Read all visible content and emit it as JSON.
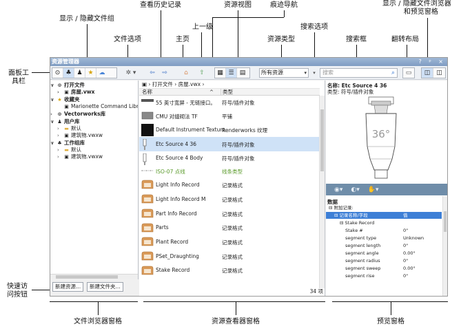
{
  "callouts": {
    "show_hide_groups": "显示 / 隐藏文件组",
    "view_history": "查看历史记录",
    "resource_view": "资源视图",
    "breadcrumb_nav": "痕迹导航",
    "show_hide_browser_1": "显示 / 隐藏文件浏览器",
    "show_hide_browser_2": "和预览窗格",
    "file_options": "文件选项",
    "home": "主页",
    "up_level": "上一级",
    "resource_type": "资源类型",
    "search_options": "搜索选项",
    "search_box": "搜索框",
    "flip_layout": "翻转布局",
    "panel_toolbar_1": "面板工",
    "panel_toolbar_2": "具栏",
    "quick_access_1": "快速访",
    "quick_access_2": "问按钮",
    "file_browser_pane": "文件浏览器窗格",
    "resource_viewer_pane": "资源查看器窗格",
    "preview_pane": "预览窗格"
  },
  "window": {
    "title": "资源管理器",
    "title_buttons": "? ᵖ ×"
  },
  "toolbar": {
    "resource_type_value": "所有资源",
    "search_placeholder": "搜索"
  },
  "tree": {
    "items": [
      {
        "label": "打开文件",
        "bold": true
      },
      {
        "label": "房屋.vwx",
        "bold": true
      },
      {
        "label": "收藏夹",
        "bold": true
      },
      {
        "label": "Marionette Command Libr",
        "bold": false
      },
      {
        "label": "Vectorworks库",
        "bold": true
      },
      {
        "label": "用户库",
        "bold": true
      },
      {
        "label": "默认",
        "bold": false
      },
      {
        "label": "建筑物.vwxw",
        "bold": false
      },
      {
        "label": "工作组库",
        "bold": true
      },
      {
        "label": "默认",
        "bold": false
      },
      {
        "label": "建筑物.vwxw",
        "bold": false
      }
    ]
  },
  "quick_access": {
    "new_resource": "新建资源...",
    "new_folder": "新建文件夹..."
  },
  "viewer": {
    "breadcrumb": [
      "打开文件",
      "房屋.vwx"
    ],
    "col_name": "名称",
    "col_type": "类型",
    "rows": [
      {
        "name": "55 英寸宽屏 - 无链接口。",
        "type": "符号/插件对象"
      },
      {
        "name": "CMU 对缝砌法 TF",
        "type": "平铺"
      },
      {
        "name": "Default Instrument Texture",
        "type": "Renderworks 纹理"
      },
      {
        "name": "Etc Source 4 36",
        "type": "符号/插件对象"
      },
      {
        "name": "Etc Source 4 Body",
        "type": "符号/插件对象"
      },
      {
        "name": "ISO-07 点线",
        "type": "线条类型"
      },
      {
        "name": "Light Info Record",
        "type": "记录格式"
      },
      {
        "name": "Light Info Record M",
        "type": "记录格式"
      },
      {
        "name": "Part Info Record",
        "type": "记录格式"
      },
      {
        "name": "Parts",
        "type": "记录格式"
      },
      {
        "name": "Plant Record",
        "type": "记录格式"
      },
      {
        "name": "PSet_Draughting",
        "type": "记录格式"
      },
      {
        "name": "Stake Record",
        "type": "记录格式"
      }
    ],
    "count": "34 项"
  },
  "preview": {
    "name": "名称: Etc Source 4 36",
    "type": "类型: 符号/插件对象",
    "image_label": "36°",
    "data_header": "数据",
    "data_rows": [
      {
        "key": "附加记录:",
        "value": "",
        "indent": 0,
        "toggle": "⊟"
      },
      {
        "key": "记录名称/字段",
        "value": "值",
        "indent": 1,
        "toggle": "⊟",
        "highlight": true
      },
      {
        "key": "Stake Record",
        "value": "",
        "indent": 2,
        "toggle": "⊟"
      },
      {
        "key": "Stake #",
        "value": "0\"",
        "indent": 3
      },
      {
        "key": "segment type",
        "value": "Unknown",
        "indent": 3
      },
      {
        "key": "segment length",
        "value": "0\"",
        "indent": 3
      },
      {
        "key": "segment angle",
        "value": "0.00°",
        "indent": 3
      },
      {
        "key": "segment radius",
        "value": "0\"",
        "indent": 3
      },
      {
        "key": "segment sweep",
        "value": "0.00°",
        "indent": 3
      },
      {
        "key": "segment rise",
        "value": "0\"",
        "indent": 3
      }
    ]
  }
}
